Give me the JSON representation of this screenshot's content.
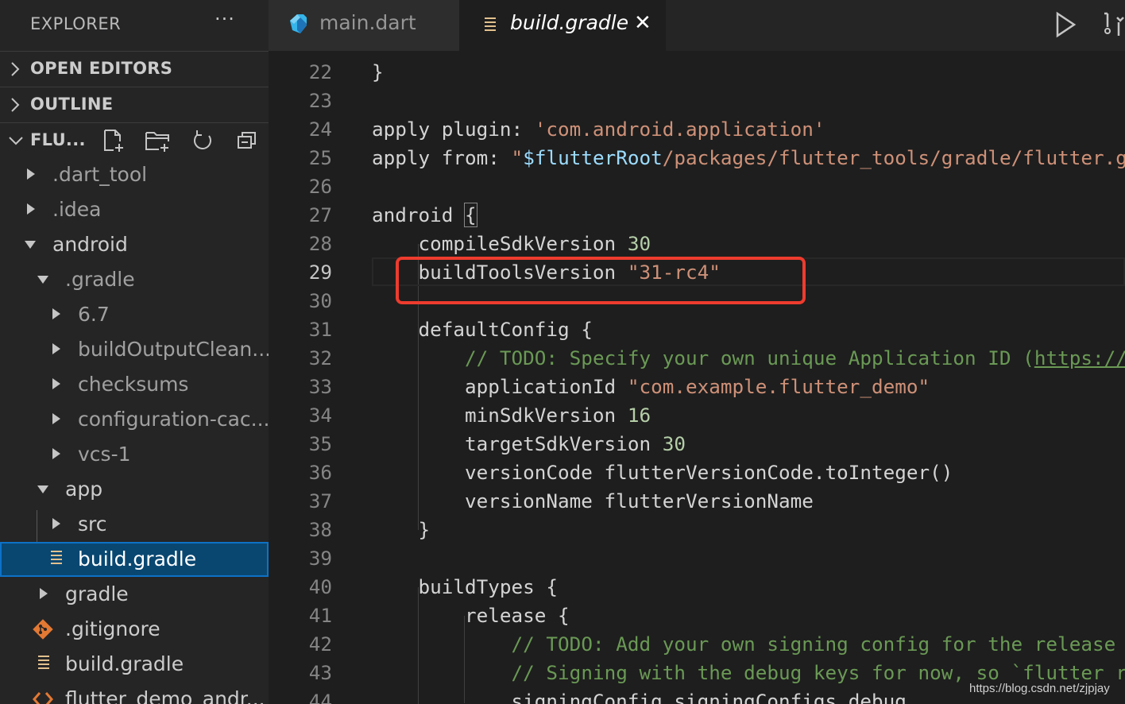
{
  "sidebar": {
    "title": "EXPLORER",
    "more": "···",
    "sections": {
      "open_editors": "OPEN EDITORS",
      "outline": "OUTLINE",
      "project": "FLU..."
    },
    "tree": [
      {
        "name": ".dart_tool",
        "type": "folder",
        "expanded": false
      },
      {
        "name": ".idea",
        "type": "folder",
        "expanded": false
      },
      {
        "name": "android",
        "type": "folder",
        "expanded": true
      },
      {
        "name": ".gradle",
        "type": "folder",
        "expanded": true
      },
      {
        "name": "6.7",
        "type": "folder",
        "expanded": false
      },
      {
        "name": "buildOutputClean...",
        "type": "folder",
        "expanded": false
      },
      {
        "name": "checksums",
        "type": "folder",
        "expanded": false
      },
      {
        "name": "configuration-cac...",
        "type": "folder",
        "expanded": false
      },
      {
        "name": "vcs-1",
        "type": "folder",
        "expanded": false
      },
      {
        "name": "app",
        "type": "folder",
        "expanded": true
      },
      {
        "name": "src",
        "type": "folder",
        "expanded": false
      },
      {
        "name": "build.gradle",
        "type": "file",
        "selected": true
      },
      {
        "name": "gradle",
        "type": "folder",
        "expanded": false
      },
      {
        "name": ".gitignore",
        "type": "git-file"
      },
      {
        "name": "build.gradle",
        "type": "file"
      },
      {
        "name": "flutter_demo_andr...",
        "type": "file"
      }
    ]
  },
  "tabs": [
    {
      "label": "main.dart",
      "icon": "dart-icon",
      "active": false
    },
    {
      "label": "build.gradle",
      "icon": "gradle-file-icon",
      "active": true,
      "close": "✕"
    }
  ],
  "editor": {
    "current_line": "29",
    "lines": [
      {
        "n": "22",
        "code": "}"
      },
      {
        "n": "23",
        "code": ""
      },
      {
        "n": "24",
        "code": "apply plugin: 'com.android.application'"
      },
      {
        "n": "25",
        "code": "apply from: \"$flutterRoot/packages/flutter_tools/gradle/flutter.gr"
      },
      {
        "n": "26",
        "code": ""
      },
      {
        "n": "27",
        "code": "android {"
      },
      {
        "n": "28",
        "code": "    compileSdkVersion 30"
      },
      {
        "n": "29",
        "code": "    buildToolsVersion \"31-rc4\""
      },
      {
        "n": "30",
        "code": ""
      },
      {
        "n": "31",
        "code": "    defaultConfig {"
      },
      {
        "n": "32",
        "code": "        // TODO: Specify your own unique Application ID (https://d"
      },
      {
        "n": "33",
        "code": "        applicationId \"com.example.flutter_demo\""
      },
      {
        "n": "34",
        "code": "        minSdkVersion 16"
      },
      {
        "n": "35",
        "code": "        targetSdkVersion 30"
      },
      {
        "n": "36",
        "code": "        versionCode flutterVersionCode.toInteger()"
      },
      {
        "n": "37",
        "code": "        versionName flutterVersionName"
      },
      {
        "n": "38",
        "code": "    }"
      },
      {
        "n": "39",
        "code": ""
      },
      {
        "n": "40",
        "code": "    buildTypes {"
      },
      {
        "n": "41",
        "code": "        release {"
      },
      {
        "n": "42",
        "code": "            // TODO: Add your own signing config for the release b"
      },
      {
        "n": "43",
        "code": "            // Signing with the debug keys for now, so `flutter ru"
      },
      {
        "n": "44",
        "code": "            signingConfig signingConfigs.debug"
      }
    ]
  },
  "watermark": "https://blog.csdn.net/zjpjay",
  "colors": {
    "highlight_box": "#ee3b2e",
    "selection": "#094771",
    "string": "#ce9178",
    "number": "#b5cea8",
    "comment": "#6a9955"
  }
}
